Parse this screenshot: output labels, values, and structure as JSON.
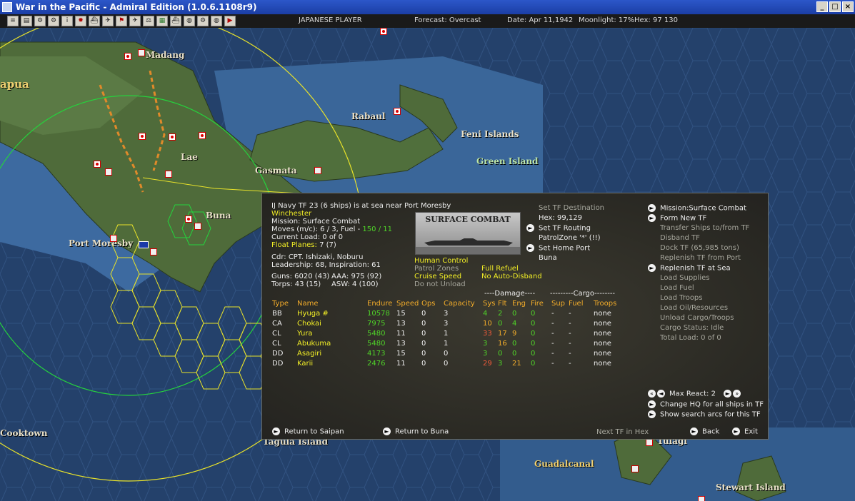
{
  "window": {
    "title": "War in the Pacific - Admiral Edition (1.0.6.1108r9)",
    "controls": [
      "_",
      "□",
      "×"
    ]
  },
  "toolbar": {
    "icons": [
      "list-icon",
      "report-icon",
      "gear-icon",
      "gear-icon",
      "info-icon",
      "sun-flag-icon",
      "ship-icon",
      "plane-icon",
      "flag-icon",
      "plane-icon",
      "scale-icon",
      "map-icon",
      "ship-icon",
      "globe-icon",
      "gear-icon",
      "globe-icon",
      "play-icon"
    ],
    "player": "JAPANESE PLAYER",
    "forecast": "Forecast: Overcast",
    "date": "Date: Apr 11,1942",
    "moonlight": "Moonlight: 17%",
    "hex": "Hex: 97 130"
  },
  "map": {
    "labels": [
      {
        "text": "Madang",
        "cls": ""
      },
      {
        "text": "apua",
        "cls": "yellow"
      },
      {
        "text": "Rabaul",
        "cls": ""
      },
      {
        "text": "Feni Islands",
        "cls": ""
      },
      {
        "text": "Green Island",
        "cls": "green"
      },
      {
        "text": "Lae",
        "cls": ""
      },
      {
        "text": "Gasmata",
        "cls": ""
      },
      {
        "text": "Buna",
        "cls": ""
      },
      {
        "text": "Port Moresby",
        "cls": ""
      },
      {
        "text": "Cooktown",
        "cls": ""
      },
      {
        "text": "Tagula Island",
        "cls": ""
      },
      {
        "text": "Guadalcanal",
        "cls": "yellow"
      },
      {
        "text": "Tulagi",
        "cls": ""
      },
      {
        "text": "Stewart Island",
        "cls": ""
      }
    ]
  },
  "panel": {
    "tf_title": "IJ Navy TF 23 (6 ships) is at sea near Port Moresby",
    "flagship": "Winchester",
    "mission": "Mission: Surface Combat",
    "moves_prefix": "Moves (m/c): 6 / 3, Fuel - ",
    "fuel": "150 / 11",
    "current_load": "Current Load: 0 of 0",
    "float_planes_label": "Float Planes: ",
    "float_planes_value": "7 (7)",
    "commander": "Cdr: CPT. Ishizaki, Noburu",
    "leadership": "Leadership: 68, Inspiration: 61",
    "guns": "Guns: 6020 (43)",
    "aaa": "AAA: 975 (92)",
    "torps": "Torps: 43 (15)",
    "asw": "ASW: 4 (100)",
    "mission_image_title": "SURFACE COMBAT",
    "human_control": "Human Control",
    "patrol_zones": "Patrol Zones",
    "cruise_speed": "Cruise Speed",
    "do_not_unload": "Do not Unload",
    "full_refuel": "Full Refuel",
    "no_auto_disband": "No Auto-Disband",
    "set_tf_destination": "Set TF Destination",
    "hex": "Hex: 99,129",
    "set_tf_routing": "Set TF Routing",
    "patrol_zone": "PatrolZone '*' (!!)",
    "set_home_port": "Set Home Port",
    "home_port": "Buna",
    "right_menu": {
      "mission_surface_combat": "Mission:Surface Combat",
      "form_new_tf": "Form New TF",
      "transfer_ships": "Transfer Ships to/from TF",
      "disband_tf": "Disband TF",
      "dock_tf": "Dock TF (65,985 tons)",
      "replenish_from_port": "Replenish TF from Port",
      "replenish_at_sea": "Replenish TF at Sea",
      "load_supplies": "Load Supplies",
      "load_fuel": "Load Fuel",
      "load_troops": "Load Troops",
      "load_oil": "Load Oil/Resources",
      "unload_cargo": "Unload Cargo/Troops",
      "cargo_status": "Cargo Status: Idle",
      "total_load": "Total Load: 0 of 0"
    },
    "damage_header": "----Damage----",
    "cargo_header": "---------Cargo--------",
    "columns": [
      "Type",
      "Name",
      "Endure",
      "Speed",
      "Ops",
      "Capacity",
      "Sys",
      "Flt",
      "Eng",
      "Fire",
      "Sup",
      "Fuel",
      "Troops"
    ],
    "ships": [
      {
        "type": "BB",
        "name": "Hyuga #",
        "endure": "10578",
        "speed": "15",
        "ops": "0",
        "capacity": "3",
        "sys": "4",
        "flt": "2",
        "eng": "0",
        "fire": "0",
        "sup": "-",
        "fuel": "-",
        "troops": "none"
      },
      {
        "type": "CA",
        "name": "Chokai",
        "endure": "7975",
        "speed": "13",
        "ops": "0",
        "capacity": "3",
        "sys": "10",
        "flt": "0",
        "eng": "4",
        "fire": "0",
        "sup": "-",
        "fuel": "-",
        "troops": "none"
      },
      {
        "type": "CL",
        "name": "Yura",
        "endure": "5480",
        "speed": "11",
        "ops": "0",
        "capacity": "1",
        "sys": "33",
        "flt": "17",
        "eng": "9",
        "fire": "0",
        "sup": "-",
        "fuel": "-",
        "troops": "none"
      },
      {
        "type": "CL",
        "name": "Abukuma",
        "endure": "5480",
        "speed": "13",
        "ops": "0",
        "capacity": "1",
        "sys": "3",
        "flt": "16",
        "eng": "0",
        "fire": "0",
        "sup": "-",
        "fuel": "-",
        "troops": "none"
      },
      {
        "type": "DD",
        "name": "Asagiri",
        "endure": "4173",
        "speed": "15",
        "ops": "0",
        "capacity": "0",
        "sys": "3",
        "flt": "0",
        "eng": "0",
        "fire": "0",
        "sup": "-",
        "fuel": "-",
        "troops": "none"
      },
      {
        "type": "DD",
        "name": "Karii",
        "endure": "2476",
        "speed": "11",
        "ops": "0",
        "capacity": "0",
        "sys": "29",
        "flt": "3",
        "eng": "21",
        "fire": "0",
        "sup": "-",
        "fuel": "-",
        "troops": "none"
      }
    ],
    "max_react": "Max React: 2",
    "change_hq": "Change HQ for all ships in TF",
    "show_search_arcs": "Show search arcs for this TF",
    "return_to_saipan": "Return to Saipan",
    "return_to_buna": "Return to Buna",
    "next_tf_in_hex": "Next TF in Hex",
    "back": "Back",
    "exit": "Exit"
  },
  "colors": {
    "accent": "#f2ee26",
    "orange": "#f2ac2a",
    "green": "#4fd428",
    "damage_red": "#f05a3a"
  }
}
